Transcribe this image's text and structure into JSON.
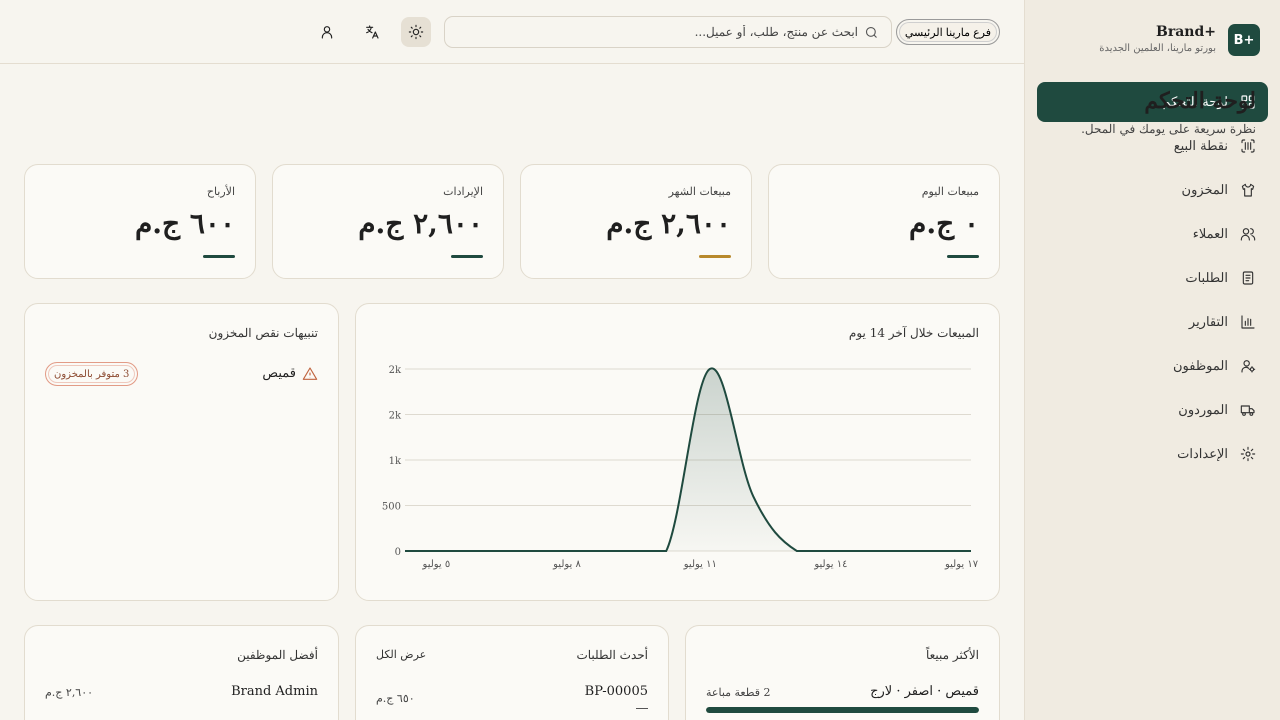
{
  "brand": {
    "logo": "B+",
    "name": "Brand+",
    "subtitle": "بورتو مارينا، العلمين الجديدة"
  },
  "sidebar": {
    "items": [
      {
        "label": "لوحة التحكم",
        "icon": "dashboard-icon",
        "active": true
      },
      {
        "label": "نقطة البيع",
        "icon": "barcode-scan-icon"
      },
      {
        "label": "المخزون",
        "icon": "shirt-icon"
      },
      {
        "label": "العملاء",
        "icon": "users-icon"
      },
      {
        "label": "الطلبات",
        "icon": "receipt-icon"
      },
      {
        "label": "التقارير",
        "icon": "bar-chart-icon"
      },
      {
        "label": "الموظفون",
        "icon": "user-cog-icon"
      },
      {
        "label": "الموردون",
        "icon": "truck-icon"
      },
      {
        "label": "الإعدادات",
        "icon": "gear-icon"
      }
    ]
  },
  "topbar": {
    "branch": "فرع مارينا الرئيسي",
    "search_placeholder": "ابحث عن منتج، طلب، أو عميل...",
    "icons": [
      "sun-icon",
      "translate-icon",
      "user-icon"
    ]
  },
  "page": {
    "title": "لوحة التحكم",
    "subtitle": "نظرة سريعة على يومك في المحل."
  },
  "stats": [
    {
      "label": "مبيعات اليوم",
      "value": "٠ ج.م",
      "accent": "#1f4a3f"
    },
    {
      "label": "مبيعات الشهر",
      "value": "٢,٦٠٠ ج.م",
      "accent": "#b8892c"
    },
    {
      "label": "الإيرادات",
      "value": "٢,٦٠٠ ج.م",
      "accent": "#1f4a3f"
    },
    {
      "label": "الأرباح",
      "value": "٦٠٠ ج.م",
      "accent": "#1f4a3f"
    }
  ],
  "sales_chart": {
    "title": "المبيعات خلال آخر 14 يوم"
  },
  "chart_data": {
    "type": "area",
    "title": "المبيعات خلال آخر 14 يوم",
    "x": [
      "٤ يوليو",
      "٥ يوليو",
      "٦ يوليو",
      "٧ يوليو",
      "٨ يوليو",
      "٩ يوليو",
      "١٠ يوليو",
      "١١ يوليو",
      "١٢ يوليو",
      "١٣ يوليو",
      "١٤ يوليو",
      "١٥ يوليو",
      "١٦ يوليو",
      "١٧ يوليو"
    ],
    "xticks": [
      "٥ يوليو",
      "٨ يوليو",
      "١١ يوليو",
      "١٤ يوليو",
      "١٧ يوليو"
    ],
    "values": [
      0,
      0,
      0,
      0,
      0,
      0,
      0,
      2000,
      600,
      0,
      0,
      0,
      0,
      0
    ],
    "yticks": [
      "0",
      "500",
      "1k",
      "2k",
      "2k"
    ],
    "ylim": [
      0,
      2000
    ],
    "grid": true,
    "color": "#1f4a3f"
  },
  "alerts": {
    "title": "تنبيهات نقص المخزون",
    "items": [
      {
        "name": "قميص",
        "badge": "3 متوفر بالمخزون"
      }
    ]
  },
  "best_sellers": {
    "title": "الأكثر مبيعاً",
    "items": [
      {
        "name": "قميص · اصفر · لارج",
        "qty": "2 قطعة مباعة",
        "share": 1.0
      }
    ]
  },
  "recent_orders": {
    "title": "أحدث الطلبات",
    "view_all": "عرض الكل",
    "items": [
      {
        "id": "BP-00005",
        "total": "٦٥٠ ج.م"
      }
    ]
  },
  "top_staff": {
    "title": "أفضل الموظفين",
    "items": [
      {
        "name": "Brand Admin",
        "total": "٢,٦٠٠ ج.م"
      }
    ]
  }
}
